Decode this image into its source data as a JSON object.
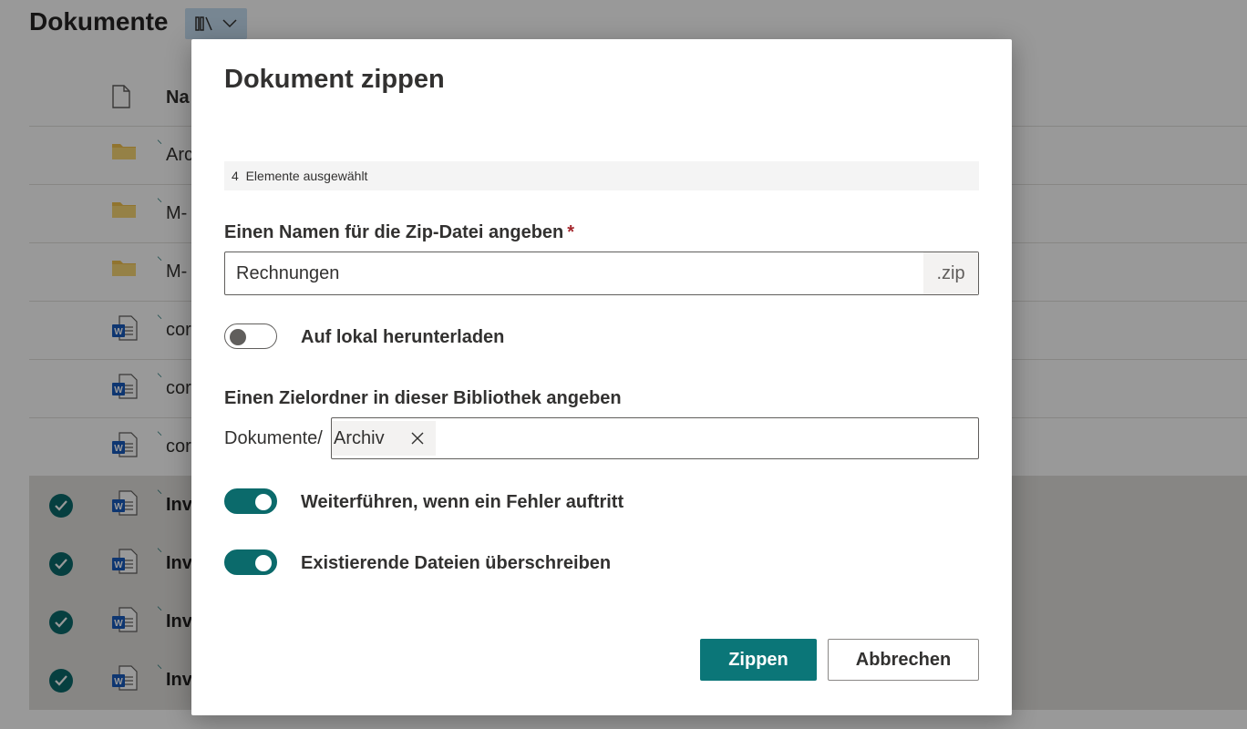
{
  "library": {
    "title": "Dokumente",
    "column_name": "Na",
    "rows": [
      {
        "name": "Arc",
        "type": "folder",
        "selected": false
      },
      {
        "name": "M-",
        "type": "folder",
        "selected": false
      },
      {
        "name": "M-",
        "type": "folder",
        "selected": false
      },
      {
        "name": "cor",
        "type": "word",
        "selected": false
      },
      {
        "name": "cor",
        "type": "word",
        "selected": false
      },
      {
        "name": "cor",
        "type": "word",
        "selected": false
      },
      {
        "name": "Inv",
        "type": "word",
        "selected": true
      },
      {
        "name": "Inv",
        "type": "word",
        "selected": true
      },
      {
        "name": "Inv",
        "type": "word",
        "selected": true
      },
      {
        "name": "Inv",
        "type": "word",
        "selected": true
      }
    ]
  },
  "dialog": {
    "title": "Dokument zippen",
    "selection_count": "4",
    "selection_text": "Elemente ausgewählt",
    "zip_name_label": "Einen Namen für die Zip-Datei angeben",
    "required_marker": "*",
    "zip_name_value": "Rechnungen",
    "zip_suffix": ".zip",
    "download_local_label": "Auf lokal herunterladen",
    "download_local_on": false,
    "target_folder_label": "Einen Zielordner in dieser Bibliothek angeben",
    "target_folder_prefix": "Dokumente/",
    "target_folder_value": "Archiv",
    "continue_on_error_label": "Weiterführen, wenn ein Fehler auftritt",
    "continue_on_error_on": true,
    "overwrite_label": "Existierende Dateien überschreiben",
    "overwrite_on": true,
    "primary_button": "Zippen",
    "secondary_button": "Abbrechen"
  },
  "colors": {
    "accent": "#0b6a6b",
    "required": "#a4262c",
    "folder": "#f2c14e",
    "word": "#185abd"
  }
}
